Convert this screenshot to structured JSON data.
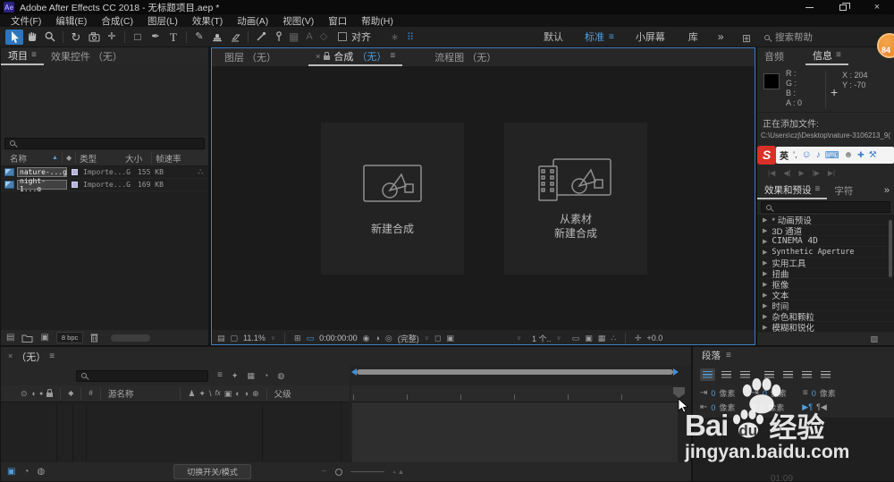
{
  "titlebar": {
    "app_badge": "Ae",
    "title": "Adobe After Effects CC 2018 - 无标题项目.aep *"
  },
  "menubar": {
    "items": [
      "文件(F)",
      "编辑(E)",
      "合成(C)",
      "图层(L)",
      "效果(T)",
      "动画(A)",
      "视图(V)",
      "窗口",
      "帮助(H)"
    ]
  },
  "toolbar": {
    "align_label": "对齐",
    "workspace_default": "默认",
    "workspace_standard": "标准",
    "workspace_small": "小屏幕",
    "workspace_library": "库",
    "workspace_more": "»",
    "search_placeholder": "搜索帮助",
    "notification_badge": "84"
  },
  "project_panel": {
    "tab_project": "项目",
    "tab_effect_controls": "效果控件 （无）",
    "col_name": "名称",
    "col_type": "类型",
    "col_size": "大小",
    "col_framerate": "帧速率",
    "rows": [
      {
        "name": "nature-...g",
        "type": "Importe...G",
        "size": "155 KB"
      },
      {
        "name": "night-1...g",
        "type": "Importe...G",
        "size": "169 KB"
      }
    ],
    "bpc_label": "8 bpc"
  },
  "comp_panel": {
    "tab_layer": "图层 （无）",
    "tab_comp_name": "合成",
    "tab_comp_none": "（无）",
    "tab_flowchart": "流程图 （无）",
    "tile_new_comp": "新建合成",
    "tile_from_footage_line1": "从素材",
    "tile_from_footage_line2": "新建合成",
    "status_zoom": "11.1%",
    "status_timecode": "0:00:00:00",
    "status_quality": "(完整)",
    "status_views": "1 个..",
    "status_exposure": "+0.0"
  },
  "info_panel": {
    "tab_audio": "音频",
    "tab_info": "信息",
    "r_label": "R :",
    "g_label": "G :",
    "b_label": "B :",
    "a_label": "A : 0",
    "x_label": "X : 204",
    "y_label": "Y : -70",
    "status_line1": "正在添加文件:",
    "status_line2": "C:\\Users\\czj\\Desktop\\nature-3106213_9("
  },
  "ime_bar": {
    "logo": "S",
    "lang": "英",
    "punct": "’,"
  },
  "effects_panel": {
    "tab_effects": "效果和预设",
    "tab_character": "字符",
    "more": "»",
    "items": [
      "* 动画预设",
      "3D 通道",
      "CINEMA 4D",
      "Synthetic Aperture",
      "实用工具",
      "扭曲",
      "抠像",
      "文本",
      "时间",
      "杂色和颗粒",
      "模糊和锐化"
    ]
  },
  "timeline": {
    "tab_none": "（无）",
    "col_source_name": "源名称",
    "col_parent": "父级",
    "toggle_modes": "切换开关/模式",
    "video_time": "01:09"
  },
  "paragraph_panel": {
    "title": "段落",
    "fields": [
      {
        "value": "0",
        "unit": "像素"
      },
      {
        "value": "0",
        "unit": "像素"
      },
      {
        "value": "0",
        "unit": "像素"
      },
      {
        "value": "0",
        "unit": "像素"
      },
      {
        "value": "0",
        "unit": "像素"
      }
    ]
  },
  "watermark": {
    "brand_bai": "Bai",
    "brand_du": "du",
    "brand_cn": "经验",
    "url": "jingyan.baidu.com"
  },
  "icons": {
    "close": "×",
    "hamburger": "≡",
    "caret": "∨",
    "chevrons": "»",
    "rotate": "↻",
    "pan": "✛",
    "shape": "□",
    "pen": "✒",
    "type": "T",
    "brush": "✎",
    "axis_grid": "▦",
    "axis_a": "A",
    "axis_diamond": "◇",
    "snap_star": "∗",
    "marquee_dots": "⠿",
    "sort_asc": "▲",
    "tag": "◆",
    "hash": "#",
    "eye": "⊙",
    "speaker": "◖",
    "solo": "●",
    "shy": "♟",
    "collapse": "✦",
    "quality": "\\",
    "fx": "fx",
    "frame_blend": "▣",
    "motion_blur": "◐",
    "adj_layer": "◑",
    "cube_3d": "⊕",
    "grid": "⊞",
    "screen": "▢",
    "snapshot": "◉",
    "channels": "◎",
    "mask": "▭",
    "region": "◻",
    "t_start": "|◀",
    "t_prev": "◀|",
    "t_play": "▶",
    "t_next": "|▶",
    "t_end": "▶|",
    "smiley": "☺",
    "music": "♪",
    "keyboard": "⌨",
    "person": "☻",
    "shirt": "✚",
    "wrench": "⚒",
    "interpret": "▤",
    "film": "▣",
    "tl_switch": "▣",
    "tl_blend": "◔",
    "tl_motion": "◍",
    "panel_fold": "▨",
    "indent_left": "⇥",
    "indent_right": "⇤",
    "indent_first": "⇥",
    "bars_lines": "≡",
    "pilcrow_r": "▶¶",
    "pilcrow_l": "¶◀",
    "minus": "−",
    "mount_small": "▲",
    "mount_large": "▲",
    "tree": "∴",
    "plus_cross": "+",
    "x_small": "×"
  }
}
